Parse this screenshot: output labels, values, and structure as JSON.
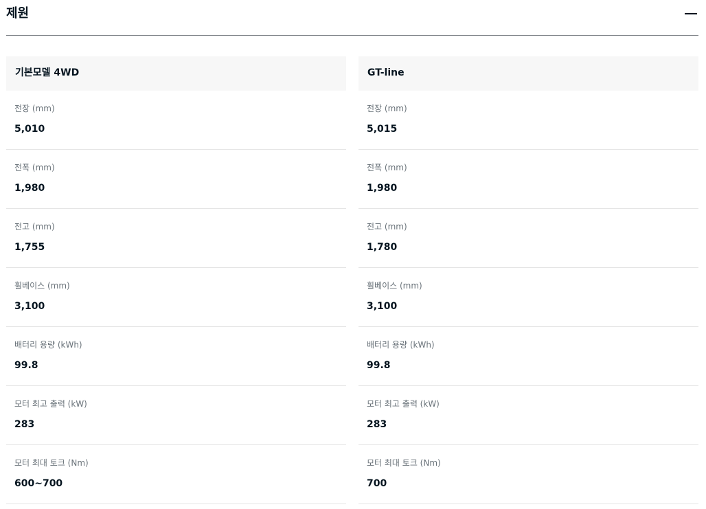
{
  "section": {
    "title": "제원",
    "collapse_icon": "minus-icon"
  },
  "columns": [
    {
      "name": "기본모델 4WD",
      "specs": [
        {
          "label": "전장 (mm)",
          "value": "5,010"
        },
        {
          "label": "전폭 (mm)",
          "value": "1,980"
        },
        {
          "label": "전고 (mm)",
          "value": "1,755"
        },
        {
          "label": "휠베이스 (mm)",
          "value": "3,100"
        },
        {
          "label": "배터리 용량 (kWh)",
          "value": "99.8"
        },
        {
          "label": "모터 최고 출력 (kW)",
          "value": "283"
        },
        {
          "label": "모터 최대 토크 (Nm)",
          "value": "600~700"
        }
      ]
    },
    {
      "name": "GT-line",
      "specs": [
        {
          "label": "전장 (mm)",
          "value": "5,015"
        },
        {
          "label": "전폭 (mm)",
          "value": "1,980"
        },
        {
          "label": "전고 (mm)",
          "value": "1,780"
        },
        {
          "label": "휠베이스 (mm)",
          "value": "3,100"
        },
        {
          "label": "배터리 용량 (kWh)",
          "value": "99.8"
        },
        {
          "label": "모터 최고 출력 (kW)",
          "value": "283"
        },
        {
          "label": "모터 최대 토크 (Nm)",
          "value": "700"
        }
      ]
    }
  ]
}
